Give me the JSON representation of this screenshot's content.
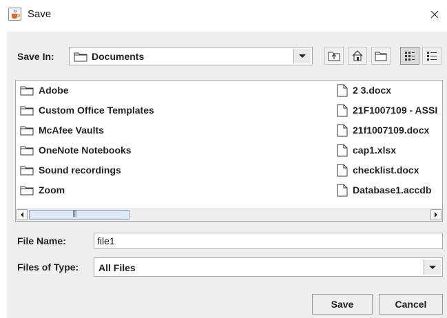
{
  "window": {
    "title": "Save",
    "close_glyph": "×"
  },
  "save_in": {
    "label": "Save In:",
    "current_folder": "Documents",
    "toolbar_icons": [
      "up-one-level-icon",
      "home-icon",
      "new-folder-icon",
      "list-view-icon",
      "details-view-icon"
    ]
  },
  "files": {
    "folders": [
      {
        "name": "Adobe",
        "icon": "folder-icon"
      },
      {
        "name": "Custom Office Templates",
        "icon": "folder-icon"
      },
      {
        "name": "McAfee Vaults",
        "icon": "folder-icon"
      },
      {
        "name": "OneNote Notebooks",
        "icon": "folder-icon"
      },
      {
        "name": "Sound recordings",
        "icon": "folder-icon"
      },
      {
        "name": "Zoom",
        "icon": "folder-icon"
      }
    ],
    "documents": [
      {
        "name": "2 3.docx",
        "icon": "file-icon"
      },
      {
        "name": "21F1007109 - ASSI",
        "icon": "file-icon"
      },
      {
        "name": "21f1007109.docx",
        "icon": "file-icon"
      },
      {
        "name": "cap1.xlsx",
        "icon": "file-icon"
      },
      {
        "name": "checklist.docx",
        "icon": "file-icon"
      },
      {
        "name": "Database1.accdb",
        "icon": "file-icon"
      }
    ],
    "scroll_thumb_glyph": "|||"
  },
  "file_name": {
    "label": "File Name:",
    "value": "file1"
  },
  "file_type": {
    "label": "Files of Type:",
    "selected": "All Files"
  },
  "buttons": {
    "save": "Save",
    "cancel": "Cancel"
  },
  "colors": {
    "dialog_bg": "#eeeeee",
    "title_bg": "#ffffff",
    "border": "#a9a9a9",
    "scroll_thumb": "#dfe8f6"
  }
}
